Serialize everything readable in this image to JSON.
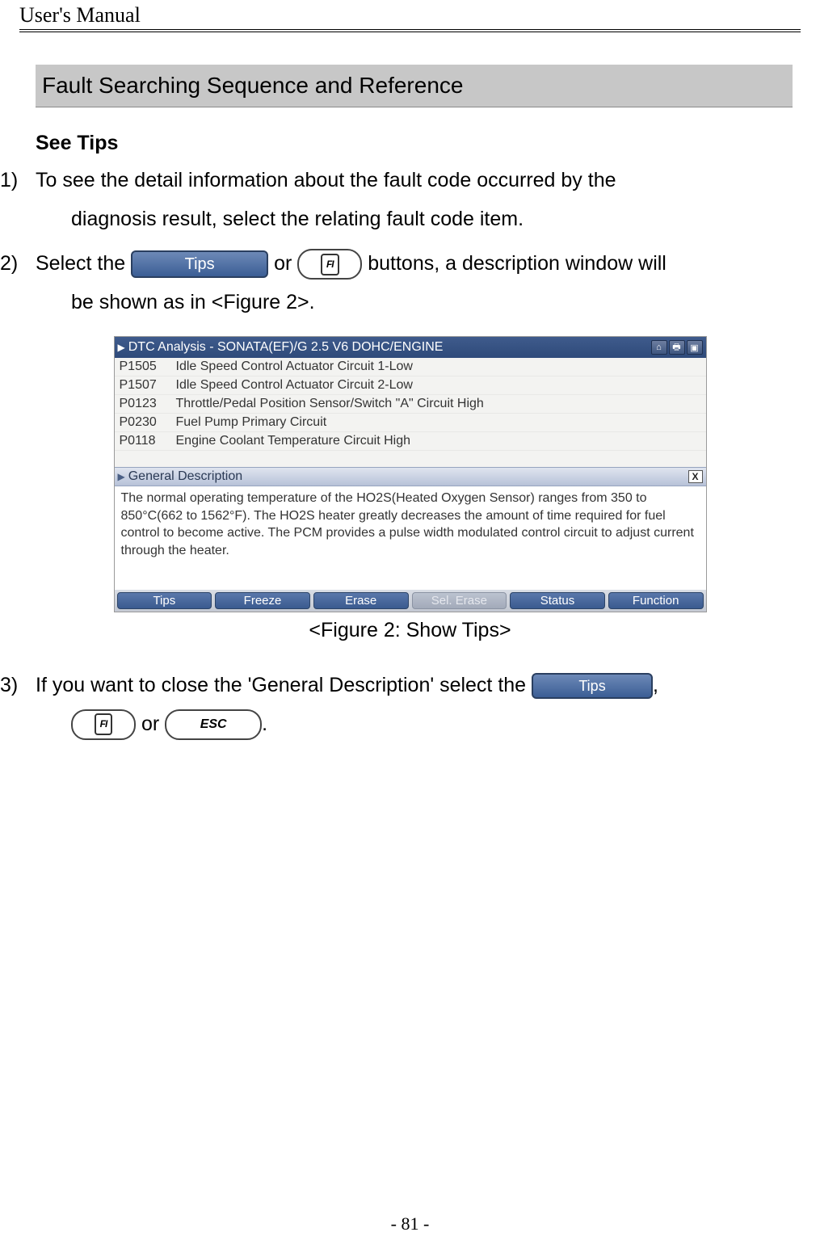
{
  "header": {
    "title": "User's Manual"
  },
  "section_title": "Fault Searching Sequence and Reference",
  "sub_heading": "See Tips",
  "steps": {
    "s1": {
      "num": "1)",
      "text_a": "To see the detail information about the fault code occurred by the",
      "text_b": "diagnosis result, select the relating fault code item."
    },
    "s2": {
      "num": "2)",
      "text_a": "Select the ",
      "text_b": " or ",
      "text_c": " buttons, a description window will",
      "text_d": "be shown as in <Figure 2>."
    },
    "s3": {
      "num": "3)",
      "text_a": "If you want to close the 'General Description' select the ",
      "text_b": ",",
      "text_c": " or ",
      "text_d": "."
    }
  },
  "buttons": {
    "tips_label": "Tips",
    "f1_label": "FI",
    "esc_label": "ESC"
  },
  "screenshot": {
    "titlebar": "DTC Analysis  - SONATA(EF)/G 2.5 V6 DOHC/ENGINE",
    "dtc": [
      {
        "code": "P1505",
        "desc": "Idle Speed Control Actuator Circuit 1-Low"
      },
      {
        "code": "P1507",
        "desc": "Idle Speed Control Actuator Circuit 2-Low"
      },
      {
        "code": "P0123",
        "desc": "Throttle/Pedal Position Sensor/Switch \"A\" Circuit High"
      },
      {
        "code": "P0230",
        "desc": "Fuel Pump Primary Circuit"
      },
      {
        "code": "P0118",
        "desc": "Engine Coolant Temperature Circuit High"
      }
    ],
    "subbar": "General Description",
    "description": "The normal operating temperature of the HO2S(Heated Oxygen Sensor) ranges from 350 to 850°C(662 to 1562°F). The HO2S heater greatly decreases the amount of time required for fuel control to become active. The PCM provides a pulse width modulated control circuit to adjust current through the heater.",
    "bottom_buttons": [
      {
        "label": "Tips",
        "disabled": false
      },
      {
        "label": "Freeze",
        "disabled": false
      },
      {
        "label": "Erase",
        "disabled": false
      },
      {
        "label": "Sel. Erase",
        "disabled": true
      },
      {
        "label": "Status",
        "disabled": false
      },
      {
        "label": "Function",
        "disabled": false
      }
    ],
    "caption": "<Figure 2: Show Tips>"
  },
  "page_number": "- 81 -"
}
